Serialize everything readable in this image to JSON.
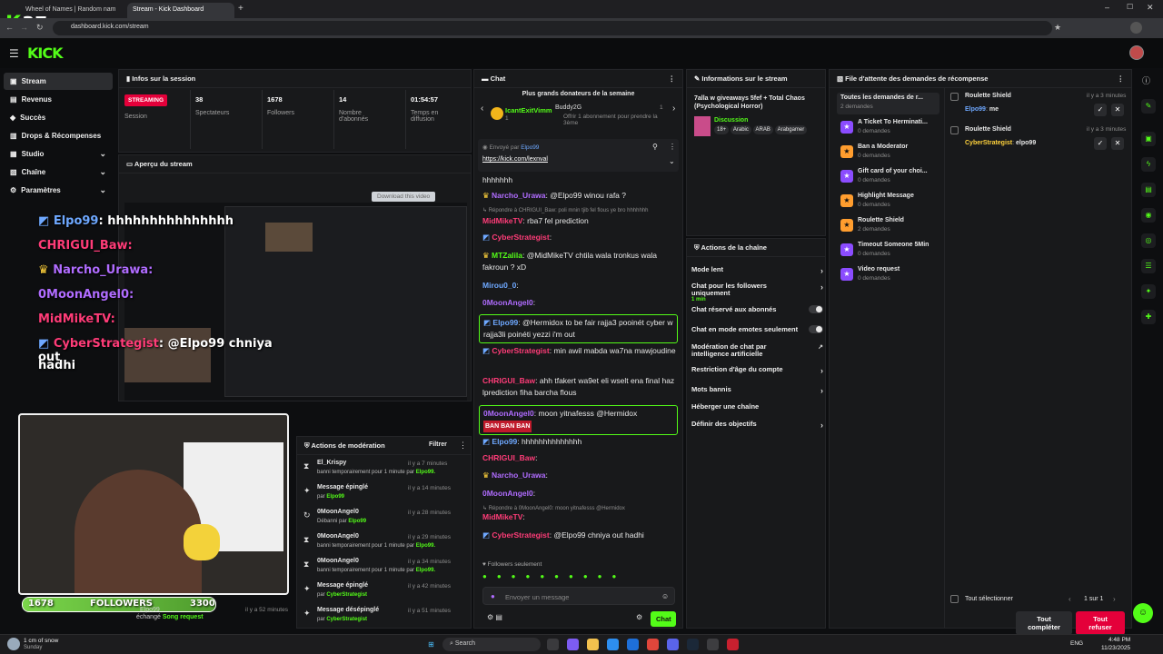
{
  "browser": {
    "tabs": [
      {
        "label": "Wheel of Names | Random nam"
      },
      {
        "label": "Stream - Kick Dashboard"
      }
    ],
    "url": "dashboard.kick.com/stream",
    "overlay_number": "37"
  },
  "kick": {
    "logo": "KICK"
  },
  "sidebar": {
    "items": [
      {
        "label": "Stream"
      },
      {
        "label": "Revenus"
      },
      {
        "label": "Succès"
      },
      {
        "label": "Drops & Récompenses"
      },
      {
        "label": "Studio"
      },
      {
        "label": "Chaîne"
      },
      {
        "label": "Paramètres"
      }
    ]
  },
  "session": {
    "title": "Infos sur la session",
    "badge": "STREAMING",
    "status_label": "Session",
    "stats": [
      {
        "value": "38",
        "label": "Spectateurs"
      },
      {
        "value": "1678",
        "label": "Followers"
      },
      {
        "value": "14",
        "label": "Nombre d'abonnés"
      },
      {
        "value": "01:54:57",
        "label": "Temps en diffusion"
      }
    ]
  },
  "preview": {
    "title": "Aperçu du stream",
    "download": "Download this video"
  },
  "overlay": {
    "lines": [
      {
        "user": "Elpo99",
        "text": ": hhhhhhhhhhhhhhh"
      },
      {
        "user": "CHRIGUI_Baw",
        "text": ":"
      },
      {
        "user": "Narcho_Urawa",
        "text": ":"
      },
      {
        "user": "0MoonAngel0",
        "text": ":"
      },
      {
        "user": "MidMikeTV",
        "text": ":"
      },
      {
        "user": "CyberStrategist",
        "text": ": @Elpo99 chniya out"
      },
      {
        "user": "",
        "text": "hadhi"
      }
    ],
    "followers_left": "1678",
    "followers_label": "FOLLOWERS",
    "followers_right": "3300"
  },
  "moderation": {
    "title": "Actions de modération",
    "filter": "Filtrer",
    "rows": [
      {
        "title": "El_Krispy",
        "sub": "banni temporairement pour 1 minute par",
        "by": "Elpo99.",
        "time": "il y a 7 minutes"
      },
      {
        "title": "Message épinglé",
        "sub": "par",
        "by": "Elpo99",
        "time": "il y a 14 minutes"
      },
      {
        "title": "0MoonAngel0",
        "sub": "Débanni par",
        "by": "Elpo99",
        "time": "il y a 28 minutes"
      },
      {
        "title": "0MoonAngel0",
        "sub": "banni temporairement pour 1 minute par",
        "by": "Elpo99.",
        "time": "il y a 29 minutes"
      },
      {
        "title": "0MoonAngel0",
        "sub": "banni temporairement pour 1 minute par",
        "by": "Elpo99.",
        "time": "il y a 34 minutes"
      },
      {
        "title": "Message épinglé",
        "sub": "par",
        "by": "CyberStrategist",
        "time": "il y a 42 minutes"
      },
      {
        "title": "Message désépinglé",
        "sub": "par",
        "by": "CyberStrategist",
        "time": "il y a 51 minutes"
      }
    ],
    "hidden_row": {
      "user": "Elpo99",
      "sub": "échangé",
      "reward": "Song request",
      "time": "il y a 52 minutes"
    }
  },
  "chat": {
    "title": "Chat",
    "donors_title": "Plus grands donateurs de la semaine",
    "donor1": {
      "name": "IcantExitVimm",
      "rank": "1"
    },
    "donor2": {
      "name": "Buddy2G",
      "desc": "Offrir 1 abonnement pour prendre la 3ème",
      "rank": "1"
    },
    "pinned_by_label": "Envoyé par",
    "pinned_by": "Elpo99",
    "pinned_link": "https://kick.com/lexnval",
    "top_msg": "hhhhhhh",
    "messages": [
      {
        "user": "Narcho_Urawa",
        "text": ": @Elpo99 winou rafa ?"
      },
      {
        "reply": "Répondre à CHRIGUI_Baw: poli mnin tjib fel flous ye bro hhhhhhh"
      },
      {
        "user": "MidMikeTV",
        "text": ": rba7 fel prediction"
      },
      {
        "user": "CyberStrategist",
        "text": ":"
      },
      {
        "user": "MTZalila",
        "text": ": @MidMikeTV chtila wala tronkus wala fakroun ? xD"
      },
      {
        "user": "Mirou0_0",
        "text": ":"
      },
      {
        "user": "0MoonAngel0",
        "text": ":"
      },
      {
        "user": "Elpo99",
        "text": ": @Hermidox to be fair rajja3 pooinét cyber w rajja3li poinéti yezzi i'm out"
      },
      {
        "user": "CyberStrategist",
        "text": ": min awil mabda wa7na mawjoudine"
      },
      {
        "user": "CHRIGUI_Baw",
        "text": ": ahh tfakert wa9et eli wselt ena final haz lprediction fiha barcha flous"
      },
      {
        "user": "0MoonAngel0",
        "text": ": moon yitnafesss @Hermidox",
        "banner": "BAN BAN BAN"
      },
      {
        "user": "Elpo99",
        "text": ": hhhhhhhhhhhhhh"
      },
      {
        "user": "CHRIGUI_Baw",
        "text": ":"
      },
      {
        "user": "Narcho_Urawa",
        "text": ":"
      },
      {
        "user": "0MoonAngel0",
        "text": ":"
      },
      {
        "reply": "Répondre à 0MoonAngel0: moon yitnafesss @Hermidox"
      },
      {
        "user": "MidMikeTV",
        "text": ":"
      },
      {
        "user": "CyberStrategist",
        "text": ": @Elpo99 chniya out hadhi"
      }
    ],
    "followers_only": "Followers seulement",
    "input_placeholder": "Envoyer un message",
    "send": "Chat"
  },
  "stream_info": {
    "title": "Informations sur le stream",
    "stream_title": "7alla w giveaways 5fef + Total Chaos (Psychological Horror)",
    "category": "Discussion",
    "tags": [
      "18+",
      "Arabic",
      "ARAB",
      "Arabgamer"
    ]
  },
  "channel_actions": {
    "title": "Actions de la chaîne",
    "items": [
      {
        "label": "Mode lent",
        "type": "chevron"
      },
      {
        "label": "Chat pour les followers uniquement",
        "sub": "1 min",
        "type": "chevron"
      },
      {
        "label": "Chat réservé aux abonnés",
        "type": "toggle"
      },
      {
        "label": "Chat en mode emotes seulement",
        "type": "toggle"
      },
      {
        "label": "Modération de chat par intelligence artificielle",
        "type": "link"
      },
      {
        "label": "Restriction d'âge du compte",
        "type": "chevron"
      },
      {
        "label": "Mots bannis",
        "type": "chevron"
      },
      {
        "label": "Héberger une chaîne",
        "type": "none"
      },
      {
        "label": "Définir des objectifs",
        "type": "chevron"
      }
    ]
  },
  "rewards": {
    "title": "File d'attente des demandes de récompense",
    "items": [
      {
        "label": "Toutes les demandes de r...",
        "sub": "2 demandes"
      },
      {
        "label": "A Ticket To Herminati...",
        "sub": "0 demandes"
      },
      {
        "label": "Ban a Moderator",
        "sub": "0 demandes"
      },
      {
        "label": "Gift card of your choi...",
        "sub": "0 demandes"
      },
      {
        "label": "Highlight Message",
        "sub": "0 demandes"
      },
      {
        "label": "Roulette Shield",
        "sub": "2 demandes"
      },
      {
        "label": "Timeout Someone 5Min",
        "sub": "0 demandes"
      },
      {
        "label": "Video request",
        "sub": "0 demandes"
      }
    ],
    "requests": [
      {
        "reward": "Roulette Shield",
        "user": "Elpo99",
        "input": "me",
        "time": "il y a 3 minutes"
      },
      {
        "reward": "Roulette Shield",
        "user": "CyberStrategist",
        "input": "elpo99",
        "time": "il y a 3 minutes"
      }
    ],
    "select_all": "Tout sélectionner",
    "pagination": "1 sur 1",
    "complete_all": "Tout compléter",
    "refuse_all": "Tout refuser"
  },
  "taskbar": {
    "weather": "1 cm of snow",
    "weather_sub": "Sunday",
    "search": "Search",
    "lang": "ENG",
    "time": "4:48 PM",
    "date": "11/23/2025"
  },
  "colors": {
    "accent": "#53fc18",
    "danger": "#e4003a"
  }
}
